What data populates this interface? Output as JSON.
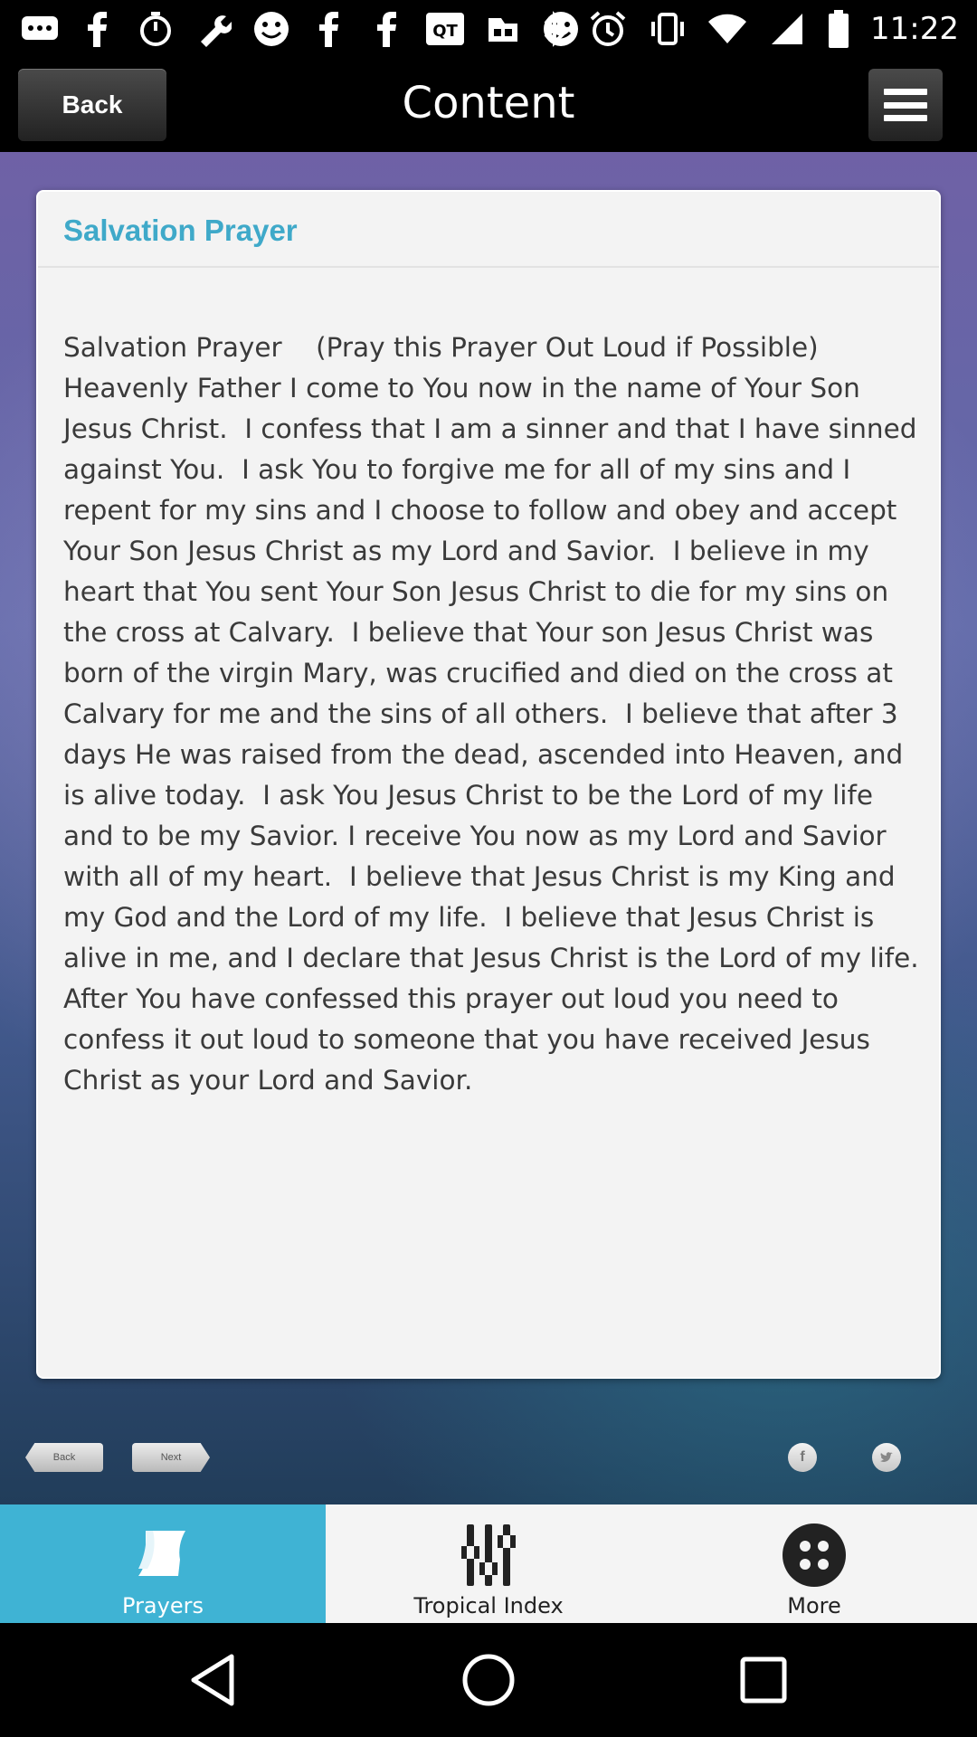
{
  "status_bar": {
    "time": "11:22",
    "left_icons": [
      "messaging-icon",
      "facebook-icon",
      "timer-icon",
      "wrench-icon",
      "smiley-icon",
      "facebook-icon",
      "facebook-icon",
      "qt-app-icon",
      "app-icon",
      "smiley-icon"
    ],
    "right_icons": [
      "bluetooth-icon",
      "alarm-icon",
      "vibrate-icon",
      "wifi-icon",
      "signal-icon",
      "battery-icon"
    ]
  },
  "header": {
    "back_label": "Back",
    "title": "Content",
    "menu_icon": "menu-icon"
  },
  "article": {
    "title": "Salvation Prayer",
    "body": "Salvation Prayer    (Pray this Prayer Out Loud if Possible) Heavenly Father I come to You now in the name of Your Son Jesus Christ.  I confess that I am a sinner and that I have sinned against You.  I ask You to forgive me for all of my sins and I repent for my sins and I choose to follow and obey and accept Your Son Jesus Christ as my Lord and Savior.  I believe in my heart that You sent Your Son Jesus Christ to die for my sins on the cross at Calvary.  I believe that Your son Jesus Christ was born of the virgin Mary, was crucified and died on the cross at Calvary for me and the sins of all others.  I believe that after 3 days He was raised from the dead, ascended into Heaven, and is alive today.  I ask You Jesus Christ to be the Lord of my life and to be my Savior. I receive You now as my Lord and Savior with all of my heart.  I believe that Jesus Christ is my King and my God and the Lord of my life.  I believe that Jesus Christ is alive in me, and I declare that Jesus Christ is the Lord of my life. After You have confessed this prayer out loud you need to confess it out loud to someone that you have received Jesus Christ as your Lord and Savior."
  },
  "pager": {
    "back_label": "Back",
    "next_label": "Next",
    "facebook_glyph": "f",
    "twitter_icon": "twitter-icon"
  },
  "tabs": [
    {
      "label": "Prayers",
      "icon": "prayer-book-icon",
      "active": true
    },
    {
      "label": "Tropical Index",
      "icon": "sliders-icon",
      "active": false
    },
    {
      "label": "More",
      "icon": "more-dots-icon",
      "active": false
    }
  ],
  "colors": {
    "accent": "#3fb3d4",
    "title_blue": "#3fa9c9",
    "body_text": "#3a3a3a",
    "card_bg": "#f3f3f3"
  }
}
